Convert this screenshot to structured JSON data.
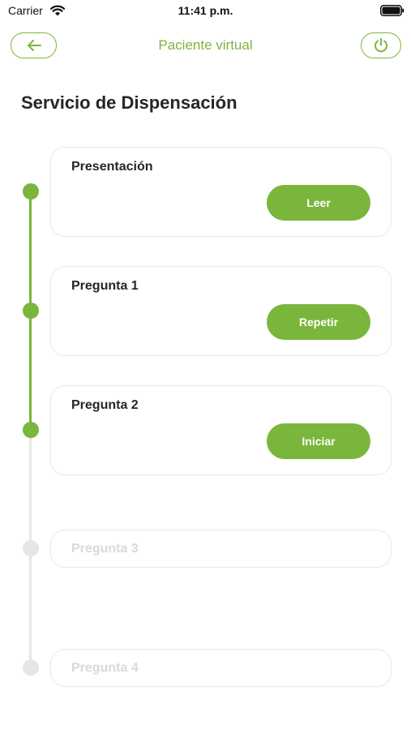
{
  "status_bar": {
    "carrier": "Carrier",
    "time": "11:41 p.m."
  },
  "nav": {
    "title": "Paciente virtual",
    "back_icon": "arrow-left-icon",
    "power_icon": "power-icon"
  },
  "page": {
    "title": "Servicio de Dispensación"
  },
  "colors": {
    "accent": "#7ab63c",
    "inactive": "#e6e6e6"
  },
  "steps": [
    {
      "title": "Presentación",
      "action_label": "Leer",
      "state": "completed"
    },
    {
      "title": "Pregunta 1",
      "action_label": "Repetir",
      "state": "completed"
    },
    {
      "title": "Pregunta 2",
      "action_label": "Iniciar",
      "state": "current"
    },
    {
      "title": "Pregunta 3",
      "state": "locked"
    },
    {
      "title": "Pregunta 4",
      "state": "locked"
    }
  ]
}
